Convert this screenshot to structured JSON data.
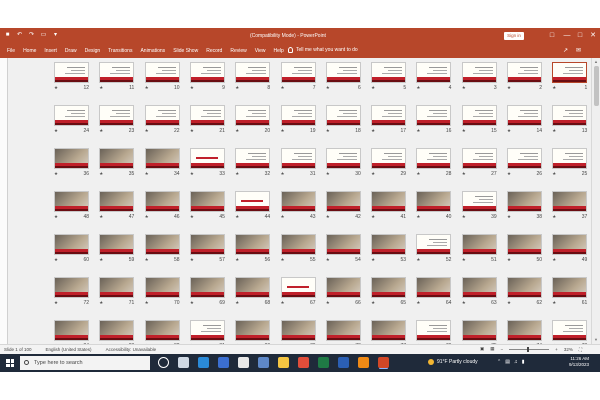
{
  "window": {
    "title": "(Compatibility Mode)  -  PowerPoint",
    "sign_in": "Sign in",
    "controls": [
      "—",
      "□",
      "✕"
    ],
    "qat_icons": [
      "save-icon",
      "undo-icon",
      "redo-icon",
      "present-icon",
      "more-icon"
    ]
  },
  "ribbon": {
    "tabs": [
      "File",
      "Home",
      "Insert",
      "Draw",
      "Design",
      "Transitions",
      "Animations",
      "Slide Show",
      "Record",
      "Review",
      "View",
      "Help"
    ],
    "tell_me": "Tell me what you want to do",
    "share_icon": "↗",
    "comment_icon": "✉"
  },
  "slides": {
    "selected": 1,
    "rows": [
      [
        12,
        11,
        10,
        9,
        8,
        7,
        6,
        5,
        4,
        3,
        2,
        1
      ],
      [
        24,
        23,
        22,
        21,
        20,
        19,
        18,
        17,
        16,
        15,
        14,
        13
      ],
      [
        36,
        35,
        34,
        33,
        32,
        31,
        30,
        29,
        28,
        27,
        26,
        25
      ],
      [
        48,
        47,
        46,
        45,
        44,
        43,
        42,
        41,
        40,
        39,
        38,
        37
      ],
      [
        60,
        59,
        58,
        57,
        56,
        55,
        54,
        53,
        52,
        51,
        50,
        49
      ],
      [
        72,
        71,
        70,
        69,
        68,
        67,
        66,
        65,
        64,
        63,
        62,
        61
      ],
      [
        84,
        83,
        82,
        81,
        80,
        79,
        78,
        77,
        76,
        75,
        74,
        73
      ]
    ],
    "photo_slides": [
      36,
      35,
      34,
      48,
      47,
      46,
      45,
      43,
      42,
      41,
      40,
      38,
      37,
      60,
      59,
      58,
      57,
      56,
      55,
      54,
      53,
      51,
      50,
      49,
      72,
      71,
      70,
      69,
      68,
      66,
      65,
      64,
      63,
      62,
      61,
      84,
      83,
      82,
      80,
      79,
      78,
      77,
      75,
      74
    ],
    "title_slides": [
      33,
      44,
      56,
      67,
      78
    ],
    "star": "★"
  },
  "status": {
    "slide_of": "Slide 1 of 100",
    "language": "English (United States)",
    "accessibility": "Accessibility: Unavailable",
    "zoom": "32%"
  },
  "taskbar": {
    "search_placeholder": "Type here to search",
    "apps": [
      "cortana-icon",
      "task-view-icon",
      "edge-icon",
      "store-icon",
      "mail-icon",
      "photos-icon",
      "explorer-icon",
      "chrome-icon",
      "excel-icon",
      "word-icon",
      "vlc-icon",
      "powerpoint-icon"
    ],
    "app_colors": [
      "#ffffff",
      "#cfd8e3",
      "#2a8ad8",
      "#3b6fd1",
      "#e8e8e8",
      "#5e88c8",
      "#f4c542",
      "#e04d3a",
      "#1f7a45",
      "#2b5fb4",
      "#f08a16",
      "#d24726"
    ],
    "weather": "91°F  Partly cloudy",
    "time": "11:26 AM",
    "date": "9/13/2023"
  }
}
